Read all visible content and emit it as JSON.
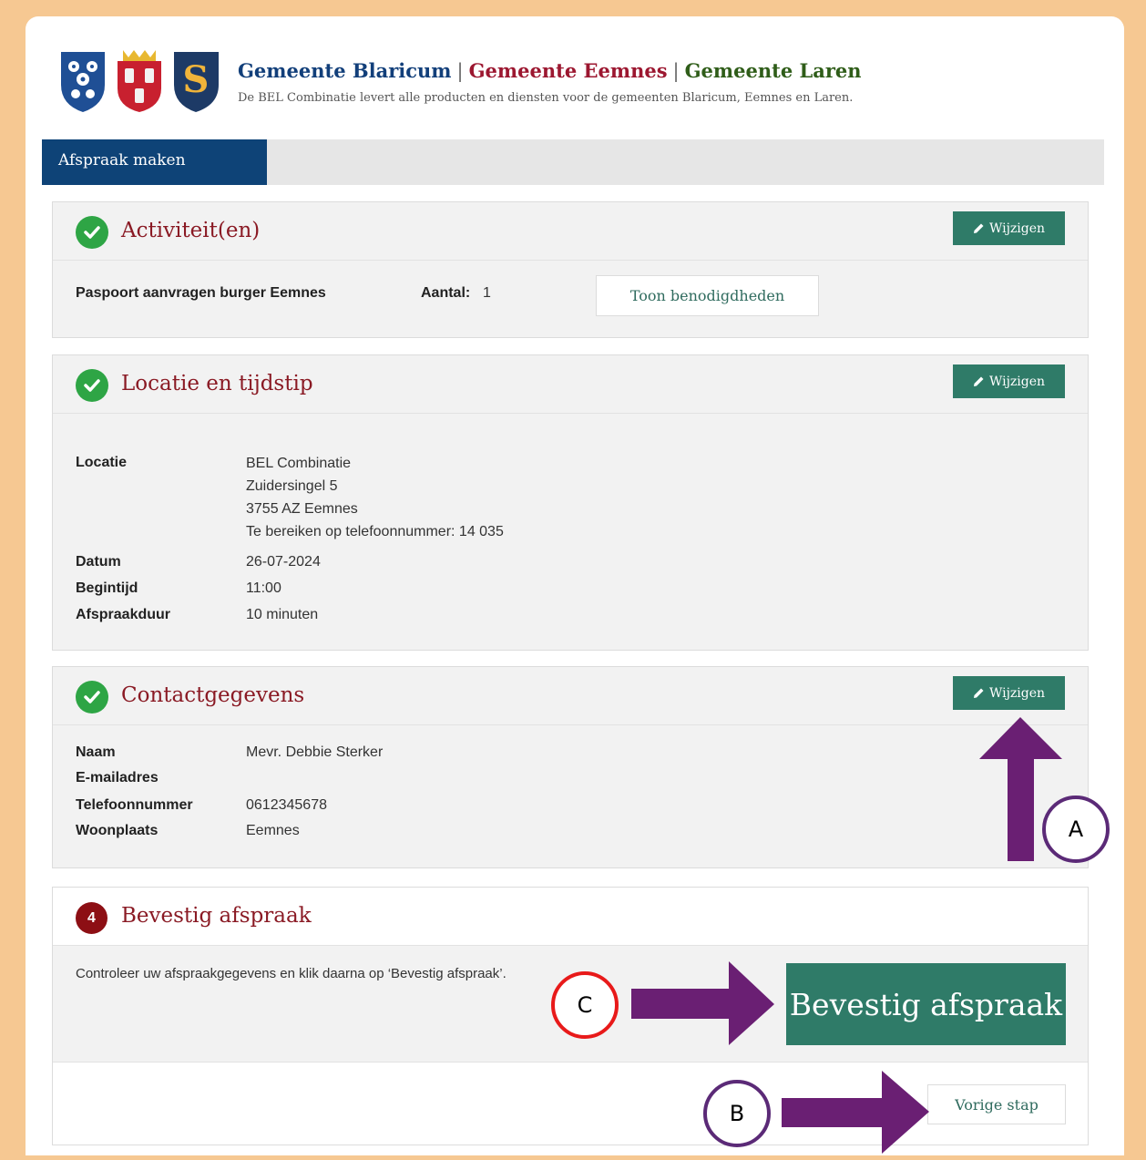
{
  "header": {
    "brand_1": "Gemeente Blaricum",
    "brand_sep": "|",
    "brand_2": "Gemeente Eemnes",
    "brand_3": "Gemeente Laren",
    "tagline": "De BEL Combinatie levert alle producten en diensten voor de gemeenten Blaricum, Eemnes en Laren.",
    "logo3_letter": "S"
  },
  "tabs": {
    "active": "Afspraak maken"
  },
  "edit_label": "Wijzigen",
  "activiteiten": {
    "title": "Activiteit(en)",
    "product": "Paspoort aanvragen burger Eemnes",
    "aantal_label": "Aantal:",
    "aantal_value": "1",
    "toon_button": "Toon benodigdheden"
  },
  "locatie": {
    "title": "Locatie en tijdstip",
    "locatie_label": "Locatie",
    "locatie_lines": [
      "BEL Combinatie",
      "Zuidersingel 5",
      "3755 AZ Eemnes",
      "Te bereiken op telefoonnummer: 14 035"
    ],
    "datum_label": "Datum",
    "datum_value": "26-07-2024",
    "begintijd_label": "Begintijd",
    "begintijd_value": "11:00",
    "duur_label": "Afspraakduur",
    "duur_value": "10 minuten"
  },
  "contact": {
    "title": "Contactgegevens",
    "naam_label": "Naam",
    "naam_value": "Mevr. Debbie Sterker",
    "email_label": "E-mailadres",
    "telefoon_label": "Telefoonnummer",
    "telefoon_value": "0612345678",
    "woonplaats_label": "Woonplaats",
    "woonplaats_value": "Eemnes"
  },
  "bevestig": {
    "step_number": "4",
    "title": "Bevestig afspraak",
    "instruction": "Controleer uw afspraakgegevens en klik daarna op ‘Bevestig afspraak’.",
    "confirm_button": "Bevestig afspraak",
    "back_button": "Vorige stap"
  },
  "annotations": {
    "a": "A",
    "b": "B",
    "c": "C"
  },
  "colors": {
    "background": "#f6c892",
    "tab_active": "#0e4377",
    "button_green": "#2f7b68",
    "title_red": "#8a1a24",
    "check_green": "#2ea545",
    "arrow_purple": "#6a1f73",
    "marker_red": "#e81a1a"
  }
}
